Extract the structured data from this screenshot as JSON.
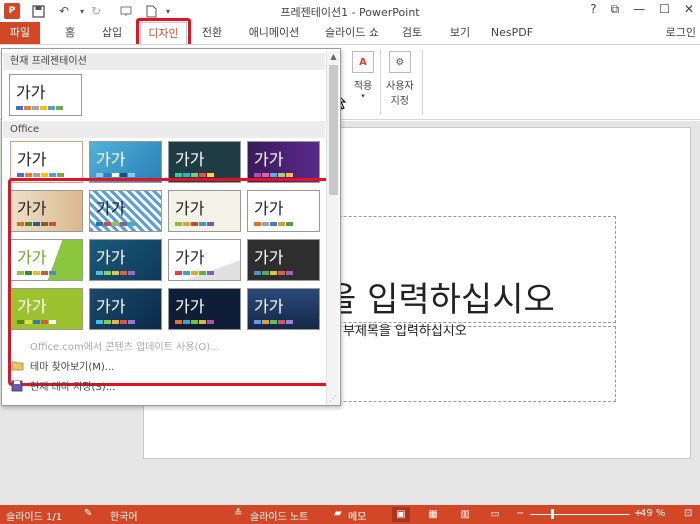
{
  "app": {
    "title": "프레젠테이션1 - PowerPoint",
    "logo": "P",
    "login": "로그인",
    "brand_color": "#d24726"
  },
  "qat": {
    "save_icon": "save-icon",
    "undo_icon": "undo-icon",
    "redo_icon": "redo-icon",
    "new_icon": "new-doc-icon"
  },
  "window": {
    "help": "?",
    "restore": "⧉",
    "minimize": "—",
    "maximize": "☐",
    "close": "✕"
  },
  "tabs": [
    "파일",
    "홈",
    "삽입",
    "디자인",
    "전환",
    "애니메이션",
    "슬라이드 쇼",
    "검토",
    "보기",
    "NesPDF"
  ],
  "ribbon": {
    "apply_label": "적용",
    "custom_size_label_1": "사용자",
    "custom_size_label_2": "지정"
  },
  "gallery": {
    "current_section": "현재 프레젠테이션",
    "office_section": "Office",
    "thumb_text": "가가",
    "menu": {
      "office_online": "Office.com에서 콘텐츠 업데이트 사용(O)...",
      "browse": "테마 찾아보기(M)...",
      "save": "현재 테마 저장(S)..."
    }
  },
  "slide": {
    "title_fragment": "을 입력하십시오",
    "subtitle_fragment": "부제목을 입력하십시오"
  },
  "status": {
    "slide": "슬라이드 1/1",
    "language": "한국어",
    "notes": "슬라이드 노트",
    "comments": "메모",
    "zoom": "49 %",
    "zoom_fraction": 0.49
  }
}
